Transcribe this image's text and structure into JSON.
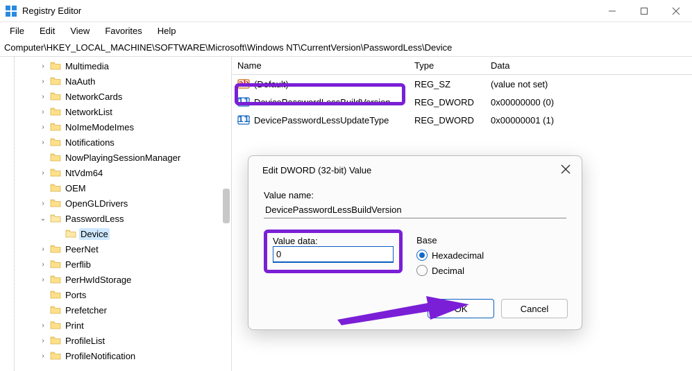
{
  "window": {
    "title": "Registry Editor"
  },
  "menubar": [
    "File",
    "Edit",
    "View",
    "Favorites",
    "Help"
  ],
  "address": "Computer\\HKEY_LOCAL_MACHINE\\SOFTWARE\\Microsoft\\Windows NT\\CurrentVersion\\PasswordLess\\Device",
  "tree": [
    {
      "label": "Multimedia",
      "exp": "collapsed"
    },
    {
      "label": "NaAuth",
      "exp": "collapsed"
    },
    {
      "label": "NetworkCards",
      "exp": "collapsed"
    },
    {
      "label": "NetworkList",
      "exp": "collapsed"
    },
    {
      "label": "NoImeModeImes",
      "exp": "collapsed"
    },
    {
      "label": "Notifications",
      "exp": "collapsed"
    },
    {
      "label": "NowPlayingSessionManager",
      "exp": "none"
    },
    {
      "label": "NtVdm64",
      "exp": "collapsed"
    },
    {
      "label": "OEM",
      "exp": "none"
    },
    {
      "label": "OpenGLDrivers",
      "exp": "collapsed"
    },
    {
      "label": "PasswordLess",
      "exp": "expanded",
      "children": [
        {
          "label": "Device",
          "selected": true
        }
      ]
    },
    {
      "label": "PeerNet",
      "exp": "collapsed"
    },
    {
      "label": "Perflib",
      "exp": "collapsed"
    },
    {
      "label": "PerHwIdStorage",
      "exp": "collapsed"
    },
    {
      "label": "Ports",
      "exp": "none"
    },
    {
      "label": "Prefetcher",
      "exp": "none"
    },
    {
      "label": "Print",
      "exp": "collapsed"
    },
    {
      "label": "ProfileList",
      "exp": "collapsed"
    },
    {
      "label": "ProfileNotification",
      "exp": "collapsed"
    }
  ],
  "list": {
    "headers": {
      "name": "Name",
      "type": "Type",
      "data": "Data"
    },
    "rows": [
      {
        "icon": "ab",
        "name": "(Default)",
        "type": "REG_SZ",
        "data": "(value not set)"
      },
      {
        "icon": "bin",
        "name": "DevicePasswordLessBuildVersion",
        "type": "REG_DWORD",
        "data": "0x00000000 (0)"
      },
      {
        "icon": "bin",
        "name": "DevicePasswordLessUpdateType",
        "type": "REG_DWORD",
        "data": "0x00000001 (1)"
      }
    ]
  },
  "dialog": {
    "title": "Edit DWORD (32-bit) Value",
    "value_name_label": "Value name:",
    "value_name": "DevicePasswordLessBuildVersion",
    "value_data_label": "Value data:",
    "value_data": "0",
    "base_label": "Base",
    "hex_label": "Hexadecimal",
    "dec_label": "Decimal",
    "ok": "OK",
    "cancel": "Cancel"
  }
}
